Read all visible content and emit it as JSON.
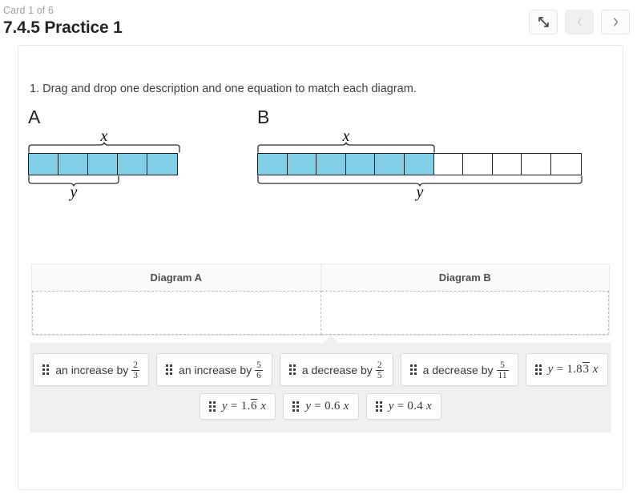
{
  "header": {
    "card_counter": "Card 1 of 6",
    "title": "7.4.5 Practice 1",
    "buttons": [
      {
        "name": "expand-button",
        "icon": "expand-arrows-icon",
        "label": "",
        "disabled": false
      },
      {
        "name": "previous-button",
        "icon": "chevron-left-icon",
        "label": "‹",
        "disabled": true
      },
      {
        "name": "next-button",
        "icon": "chevron-right-icon",
        "label": "›",
        "disabled": false
      }
    ]
  },
  "question": {
    "number": "1.",
    "text": "1. Drag and drop one description and one equation to match each diagram."
  },
  "diagrams": [
    {
      "letter": "A",
      "top_brace_label": "x",
      "bottom_brace_label": "y",
      "total_cells": 5,
      "filled_cells": 5,
      "top_brace_span": 5,
      "bottom_brace_span": 3,
      "fill_color": "#80cfe6"
    },
    {
      "letter": "B",
      "top_brace_label": "x",
      "bottom_brace_label": "y",
      "total_cells": 11,
      "filled_cells": 6,
      "top_brace_span": 6,
      "bottom_brace_span": 11,
      "fill_color": "#80cfe6"
    }
  ],
  "dropzone": {
    "columns": [
      {
        "header": "Diagram A",
        "content": ""
      },
      {
        "header": "Diagram B",
        "content": ""
      }
    ]
  },
  "tray": {
    "rows": [
      [
        {
          "kind": "description",
          "prefix": "an increase by",
          "fraction": {
            "num": "2",
            "den": "3"
          },
          "plain": "an increase by 2/3"
        },
        {
          "kind": "description",
          "prefix": "an increase by",
          "fraction": {
            "num": "5",
            "den": "6"
          },
          "plain": "an increase by 5/6"
        },
        {
          "kind": "description",
          "prefix": "a decrease by",
          "fraction": {
            "num": "2",
            "den": "5"
          },
          "plain": "a decrease by 2/5"
        },
        {
          "kind": "description",
          "prefix": "a decrease by",
          "fraction": {
            "num": "5",
            "den": "11"
          },
          "plain": "a decrease by 5/11"
        },
        {
          "kind": "equation",
          "lhs": "y",
          "op": "=",
          "coef_pre": "1.8",
          "coef_rep": "3",
          "coef_post": "",
          "var": "x",
          "plain": "y = 1.83̅ x"
        }
      ],
      [
        {
          "kind": "equation",
          "lhs": "y",
          "op": "=",
          "coef_pre": "1.",
          "coef_rep": "6",
          "coef_post": "",
          "var": "x",
          "plain": "y = 1.6̅ x"
        },
        {
          "kind": "equation",
          "lhs": "y",
          "op": "=",
          "coef_pre": "0.6",
          "coef_rep": "",
          "coef_post": "",
          "var": "x",
          "plain": "y = 0.6 x"
        },
        {
          "kind": "equation",
          "lhs": "y",
          "op": "=",
          "coef_pre": "0.4",
          "coef_rep": "",
          "coef_post": "",
          "var": "x",
          "plain": "y = 0.4 x"
        }
      ]
    ]
  },
  "colors": {
    "cell_fill": "#80cfe6",
    "cell_stroke": "#1c1c1c",
    "tray_bg": "#f0f0f0",
    "card_border": "#e6e7e9",
    "muted_text": "#9aa0a6"
  }
}
